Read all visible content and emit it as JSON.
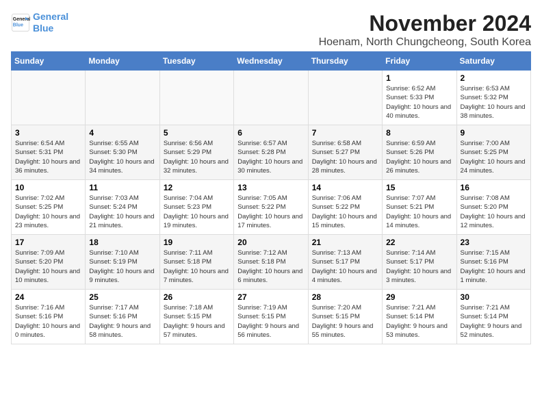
{
  "logo": {
    "line1": "General",
    "line2": "Blue",
    "tagline": ""
  },
  "title": "November 2024",
  "subtitle": "Hoenam, North Chungcheong, South Korea",
  "days_of_week": [
    "Sunday",
    "Monday",
    "Tuesday",
    "Wednesday",
    "Thursday",
    "Friday",
    "Saturday"
  ],
  "weeks": [
    [
      {
        "day": "",
        "info": ""
      },
      {
        "day": "",
        "info": ""
      },
      {
        "day": "",
        "info": ""
      },
      {
        "day": "",
        "info": ""
      },
      {
        "day": "",
        "info": ""
      },
      {
        "day": "1",
        "info": "Sunrise: 6:52 AM\nSunset: 5:33 PM\nDaylight: 10 hours and 40 minutes."
      },
      {
        "day": "2",
        "info": "Sunrise: 6:53 AM\nSunset: 5:32 PM\nDaylight: 10 hours and 38 minutes."
      }
    ],
    [
      {
        "day": "3",
        "info": "Sunrise: 6:54 AM\nSunset: 5:31 PM\nDaylight: 10 hours and 36 minutes."
      },
      {
        "day": "4",
        "info": "Sunrise: 6:55 AM\nSunset: 5:30 PM\nDaylight: 10 hours and 34 minutes."
      },
      {
        "day": "5",
        "info": "Sunrise: 6:56 AM\nSunset: 5:29 PM\nDaylight: 10 hours and 32 minutes."
      },
      {
        "day": "6",
        "info": "Sunrise: 6:57 AM\nSunset: 5:28 PM\nDaylight: 10 hours and 30 minutes."
      },
      {
        "day": "7",
        "info": "Sunrise: 6:58 AM\nSunset: 5:27 PM\nDaylight: 10 hours and 28 minutes."
      },
      {
        "day": "8",
        "info": "Sunrise: 6:59 AM\nSunset: 5:26 PM\nDaylight: 10 hours and 26 minutes."
      },
      {
        "day": "9",
        "info": "Sunrise: 7:00 AM\nSunset: 5:25 PM\nDaylight: 10 hours and 24 minutes."
      }
    ],
    [
      {
        "day": "10",
        "info": "Sunrise: 7:02 AM\nSunset: 5:25 PM\nDaylight: 10 hours and 23 minutes."
      },
      {
        "day": "11",
        "info": "Sunrise: 7:03 AM\nSunset: 5:24 PM\nDaylight: 10 hours and 21 minutes."
      },
      {
        "day": "12",
        "info": "Sunrise: 7:04 AM\nSunset: 5:23 PM\nDaylight: 10 hours and 19 minutes."
      },
      {
        "day": "13",
        "info": "Sunrise: 7:05 AM\nSunset: 5:22 PM\nDaylight: 10 hours and 17 minutes."
      },
      {
        "day": "14",
        "info": "Sunrise: 7:06 AM\nSunset: 5:22 PM\nDaylight: 10 hours and 15 minutes."
      },
      {
        "day": "15",
        "info": "Sunrise: 7:07 AM\nSunset: 5:21 PM\nDaylight: 10 hours and 14 minutes."
      },
      {
        "day": "16",
        "info": "Sunrise: 7:08 AM\nSunset: 5:20 PM\nDaylight: 10 hours and 12 minutes."
      }
    ],
    [
      {
        "day": "17",
        "info": "Sunrise: 7:09 AM\nSunset: 5:20 PM\nDaylight: 10 hours and 10 minutes."
      },
      {
        "day": "18",
        "info": "Sunrise: 7:10 AM\nSunset: 5:19 PM\nDaylight: 10 hours and 9 minutes."
      },
      {
        "day": "19",
        "info": "Sunrise: 7:11 AM\nSunset: 5:18 PM\nDaylight: 10 hours and 7 minutes."
      },
      {
        "day": "20",
        "info": "Sunrise: 7:12 AM\nSunset: 5:18 PM\nDaylight: 10 hours and 6 minutes."
      },
      {
        "day": "21",
        "info": "Sunrise: 7:13 AM\nSunset: 5:17 PM\nDaylight: 10 hours and 4 minutes."
      },
      {
        "day": "22",
        "info": "Sunrise: 7:14 AM\nSunset: 5:17 PM\nDaylight: 10 hours and 3 minutes."
      },
      {
        "day": "23",
        "info": "Sunrise: 7:15 AM\nSunset: 5:16 PM\nDaylight: 10 hours and 1 minute."
      }
    ],
    [
      {
        "day": "24",
        "info": "Sunrise: 7:16 AM\nSunset: 5:16 PM\nDaylight: 10 hours and 0 minutes."
      },
      {
        "day": "25",
        "info": "Sunrise: 7:17 AM\nSunset: 5:16 PM\nDaylight: 9 hours and 58 minutes."
      },
      {
        "day": "26",
        "info": "Sunrise: 7:18 AM\nSunset: 5:15 PM\nDaylight: 9 hours and 57 minutes."
      },
      {
        "day": "27",
        "info": "Sunrise: 7:19 AM\nSunset: 5:15 PM\nDaylight: 9 hours and 56 minutes."
      },
      {
        "day": "28",
        "info": "Sunrise: 7:20 AM\nSunset: 5:15 PM\nDaylight: 9 hours and 55 minutes."
      },
      {
        "day": "29",
        "info": "Sunrise: 7:21 AM\nSunset: 5:14 PM\nDaylight: 9 hours and 53 minutes."
      },
      {
        "day": "30",
        "info": "Sunrise: 7:21 AM\nSunset: 5:14 PM\nDaylight: 9 hours and 52 minutes."
      }
    ]
  ]
}
